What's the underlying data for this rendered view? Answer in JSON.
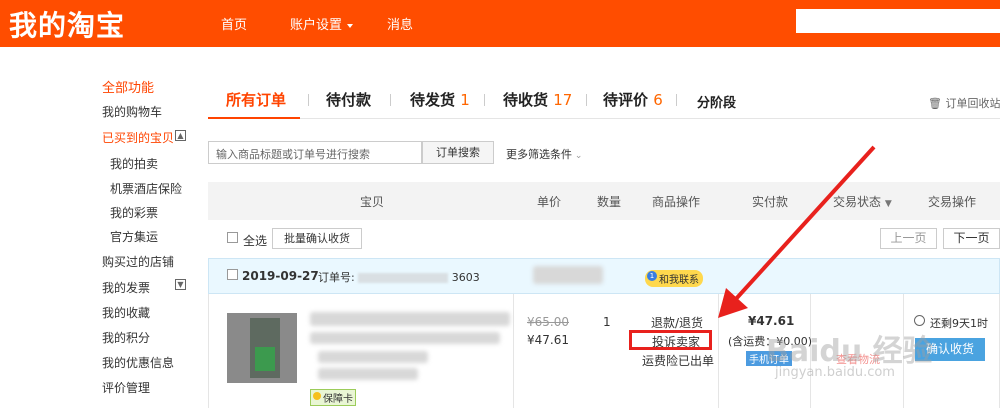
{
  "header": {
    "logo": "我的淘宝",
    "nav": [
      "首页",
      "账户设置",
      "消息"
    ]
  },
  "sidebar": {
    "all": "全部功能",
    "items": [
      "我的购物车",
      "已买到的宝贝",
      "我的拍卖",
      "机票酒店保险",
      "我的彩票",
      "官方集运",
      "购买过的店铺",
      "我的发票",
      "我的收藏",
      "我的积分",
      "我的优惠信息",
      "评价管理"
    ]
  },
  "tabs": {
    "all": "所有订单",
    "unpaid": "待付款",
    "to_ship": "待发货",
    "to_ship_count": "1",
    "to_receive": "待收货",
    "to_receive_count": "17",
    "to_review": "待评价",
    "to_review_count": "6",
    "installment": "分阶段",
    "recycle": "订单回收站"
  },
  "search": {
    "placeholder": "输入商品标题或订单号进行搜索",
    "button": "订单搜索",
    "more": "更多筛选条件"
  },
  "table_header": {
    "item": "宝贝",
    "price": "单价",
    "qty": "数量",
    "item_op": "商品操作",
    "paid": "实付款",
    "status": "交易状态",
    "trade_op": "交易操作"
  },
  "batch": {
    "select_all": "全选",
    "confirm": "批量确认收货",
    "prev": "上一页",
    "next": "下一页"
  },
  "order": {
    "date": "2019-09-27",
    "order_no_label": "订单号:",
    "order_no_tail": "3603",
    "contact": "和我联系",
    "badge": "保障卡",
    "price_old": "¥65.00",
    "price_new": "¥47.61",
    "qty": "1",
    "refund": "退款/退货",
    "complain": "投诉卖家",
    "insurance": "运费险已出单",
    "paid": "¥47.61",
    "paid_note": "(含运费：¥0.00)",
    "mobile_tag": "手机订单",
    "detail": "查看物流",
    "remaining": "还剩9天1时",
    "confirm": "确认收货"
  },
  "watermark": {
    "text": "Baidu 经验",
    "sub": "jingyan.baidu.com"
  },
  "colors": {
    "brand": "#ff4d00",
    "accent": "#ff4400",
    "highlight": "#e8211d"
  }
}
